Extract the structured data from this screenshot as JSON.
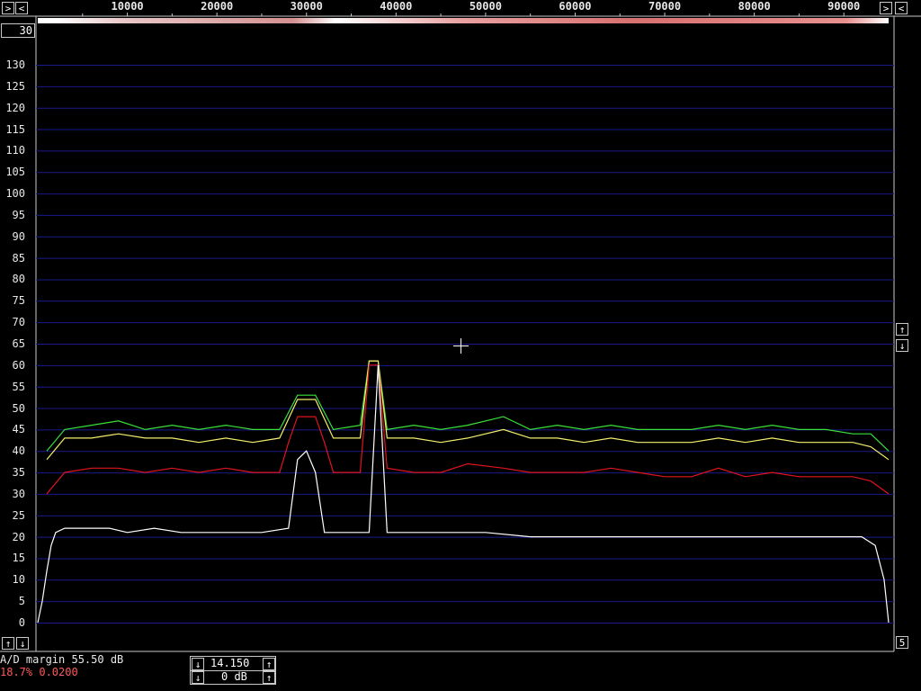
{
  "colors": {
    "background": "#000000",
    "grid": "#1a1a8c",
    "frame": "#c8c8c8",
    "trace_green": "#39e03a",
    "trace_yellow": "#f4ee6a",
    "trace_red": "#e0141c",
    "trace_white": "#ffffff",
    "status_red": "#ff5a5a"
  },
  "frequency_axis": {
    "ticks": [
      "10000",
      "20000",
      "30000",
      "40000",
      "50000",
      "60000",
      "70000",
      "80000",
      "90000"
    ],
    "nav_left_icon": "arrow-right-icon",
    "nav_left_icon2": "arrow-left-icon",
    "nav_right_icon": "arrow-right-icon",
    "nav_right_icon2": "arrow-left-icon"
  },
  "topleft_box": {
    "value": "30"
  },
  "level_axis": {
    "ticks": [
      "130",
      "125",
      "120",
      "115",
      "110",
      "105",
      "100",
      "95",
      "90",
      "85",
      "80",
      "75",
      "70",
      "65",
      "60",
      "55",
      "50",
      "45",
      "40",
      "35",
      "30",
      "25",
      "20",
      "15",
      "10",
      "5",
      "0"
    ]
  },
  "right_controls": {
    "up_icon": "arrow-up-icon",
    "down_icon": "arrow-down-icon",
    "bottom_value": "5"
  },
  "bottom_left_controls": {
    "up_icon": "arrow-up-icon",
    "down_icon": "arrow-down-icon"
  },
  "status": {
    "ad_margin": "A/D margin 55.50 dB",
    "percent_line": "18.7% 0.0200"
  },
  "gain_box": {
    "freq_value": "14.150",
    "db_value": "0 dB"
  },
  "chart_data": {
    "type": "line",
    "xlabel": "",
    "ylabel": "",
    "xlim": [
      0,
      95000
    ],
    "ylim": [
      0,
      130
    ],
    "grid": true,
    "series": [
      {
        "color": "#39e03a",
        "x": [
          1000,
          3000,
          6000,
          9000,
          12000,
          15000,
          18000,
          21000,
          24000,
          27000,
          29000,
          31000,
          33000,
          36000,
          37000,
          38000,
          39000,
          42000,
          45000,
          48000,
          52000,
          55000,
          58000,
          61000,
          64000,
          67000,
          70000,
          73000,
          76000,
          79000,
          82000,
          85000,
          88000,
          91000,
          93000,
          95000
        ],
        "values": [
          40,
          45,
          46,
          47,
          45,
          46,
          45,
          46,
          45,
          45,
          53,
          53,
          45,
          46,
          61,
          61,
          45,
          46,
          45,
          46,
          48,
          45,
          46,
          45,
          46,
          45,
          45,
          45,
          46,
          45,
          46,
          45,
          45,
          44,
          44,
          40
        ]
      },
      {
        "color": "#f4ee6a",
        "x": [
          1000,
          3000,
          6000,
          9000,
          12000,
          15000,
          18000,
          21000,
          24000,
          27000,
          29000,
          31000,
          33000,
          36000,
          37000,
          38000,
          39000,
          42000,
          45000,
          48000,
          52000,
          55000,
          58000,
          61000,
          64000,
          67000,
          70000,
          73000,
          76000,
          79000,
          82000,
          85000,
          88000,
          91000,
          93000,
          95000
        ],
        "values": [
          38,
          43,
          43,
          44,
          43,
          43,
          42,
          43,
          42,
          43,
          52,
          52,
          43,
          43,
          61,
          61,
          43,
          43,
          42,
          43,
          45,
          43,
          43,
          42,
          43,
          42,
          42,
          42,
          43,
          42,
          43,
          42,
          42,
          42,
          41,
          38
        ]
      },
      {
        "color": "#e0141c",
        "x": [
          1000,
          3000,
          6000,
          9000,
          12000,
          15000,
          18000,
          21000,
          24000,
          27000,
          28000,
          29000,
          31000,
          32000,
          33000,
          36000,
          37000,
          38000,
          39000,
          42000,
          45000,
          48000,
          52000,
          55000,
          58000,
          61000,
          64000,
          67000,
          70000,
          73000,
          76000,
          79000,
          82000,
          85000,
          88000,
          91000,
          93000,
          95000
        ],
        "values": [
          30,
          35,
          36,
          36,
          35,
          36,
          35,
          36,
          35,
          35,
          42,
          48,
          48,
          42,
          35,
          35,
          60,
          60,
          36,
          35,
          35,
          37,
          36,
          35,
          35,
          35,
          36,
          35,
          34,
          34,
          36,
          34,
          35,
          34,
          34,
          34,
          33,
          30
        ]
      },
      {
        "color": "#ffffff",
        "x": [
          0,
          500,
          1000,
          1500,
          2000,
          3000,
          5000,
          8000,
          10000,
          13000,
          16000,
          20000,
          25000,
          28000,
          29000,
          30000,
          31000,
          32000,
          35000,
          37000,
          38000,
          39000,
          42000,
          45000,
          50000,
          55000,
          60000,
          65000,
          70000,
          75000,
          80000,
          85000,
          90000,
          92000,
          93500,
          94500,
          95000
        ],
        "values": [
          0,
          5,
          12,
          18,
          21,
          22,
          22,
          22,
          21,
          22,
          21,
          21,
          21,
          22,
          38,
          40,
          35,
          21,
          21,
          21,
          60,
          21,
          21,
          21,
          21,
          20,
          20,
          20,
          20,
          20,
          20,
          20,
          20,
          20,
          18,
          10,
          0
        ]
      }
    ]
  }
}
